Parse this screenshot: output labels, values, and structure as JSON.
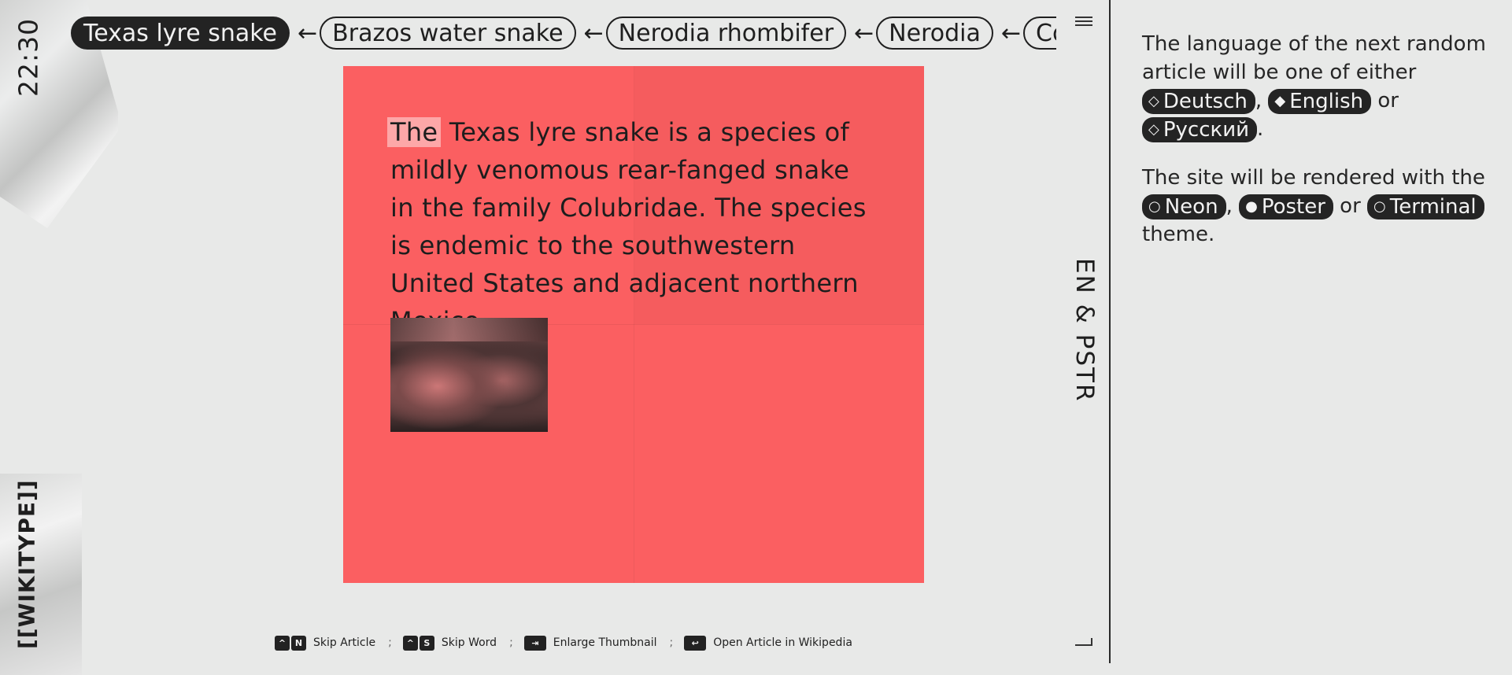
{
  "clock": "22:30",
  "logo": "[[WIKITYPE]]",
  "breadcrumbs": [
    {
      "label": "Texas lyre snake",
      "active": true
    },
    {
      "label": "Brazos water snake"
    },
    {
      "label": "Nerodia rhombifer"
    },
    {
      "label": "Nerodia"
    },
    {
      "label": "Commo"
    }
  ],
  "arrow": "←",
  "mode_label": "EN & PSTR",
  "article": {
    "typed": "The",
    "rest": " Texas lyre snake is a species of mildly venomous rear-fanged snake in the family Colubridae. The species is endemic to the southwestern United States and adjacent northern Mexico."
  },
  "poster_color": "#fb5f61",
  "hints": [
    {
      "keys": [
        "^",
        "N"
      ],
      "label": "Skip Article"
    },
    {
      "keys": [
        "^",
        "S"
      ],
      "label": "Skip Word"
    },
    {
      "keys": [
        "⇥"
      ],
      "label": "Enlarge Thumbnail"
    },
    {
      "keys": [
        "↩"
      ],
      "label": "Open Article in Wikipedia"
    }
  ],
  "hint_separator": ";",
  "panel": {
    "lang_intro": "The language of the next random article will be one of either",
    "languages": [
      {
        "label": "Deutsch",
        "glyph": "◇"
      },
      {
        "label": "English",
        "glyph": "◆"
      },
      {
        "label": "Русский",
        "glyph": "◇"
      }
    ],
    "comma": ",",
    "or": "or",
    "period": ".",
    "theme_intro": "The site will be rendered with the",
    "themes": [
      {
        "label": "Neon",
        "glyph": "○"
      },
      {
        "label": "Poster",
        "glyph": "●"
      },
      {
        "label": "Terminal",
        "glyph": "○"
      }
    ],
    "theme_outro": "theme."
  },
  "icons": [
    "menu-icon",
    "corner-icon",
    "diamond-outline-icon",
    "diamond-filled-icon",
    "circle-outline-icon",
    "circle-filled-icon"
  ]
}
